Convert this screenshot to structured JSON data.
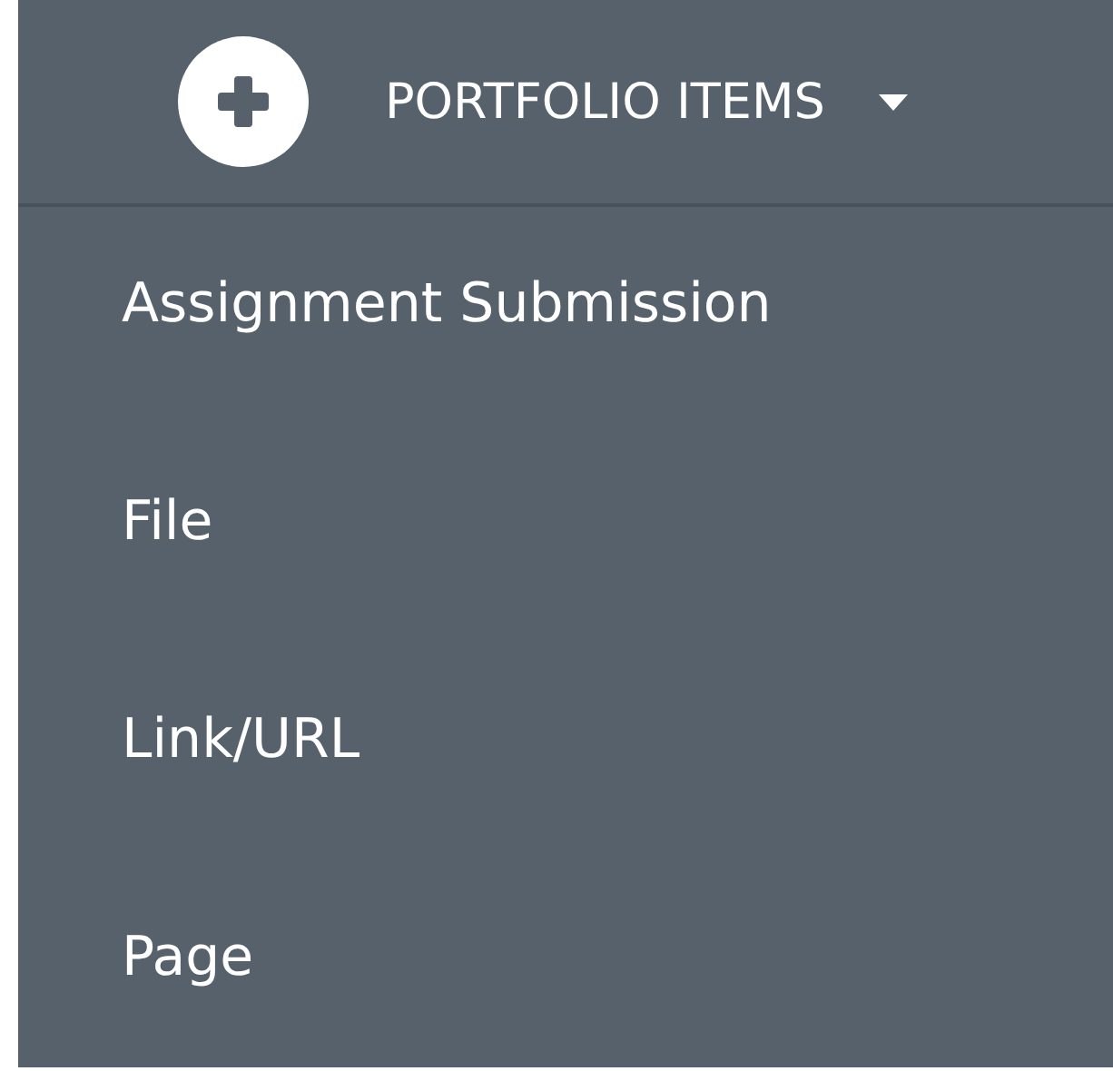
{
  "header": {
    "title": "PORTFOLIO ITEMS"
  },
  "menu_items": [
    {
      "label": "Assignment Submission"
    },
    {
      "label": "File"
    },
    {
      "label": "Link/URL"
    },
    {
      "label": "Page"
    }
  ]
}
